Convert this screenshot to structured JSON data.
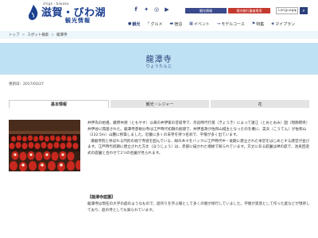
{
  "header": {
    "logo_sub": "shiga · biwako",
    "logo_main": "滋賀・びわ湖",
    "logo_tag": "観光情報",
    "social": [
      "f-icon",
      "twitter-icon",
      "instagram-icon",
      "youtube-icon"
    ],
    "top_tabs": [
      "観光情報",
      "県内旅行業者専用"
    ],
    "language_label": "Language",
    "nav": [
      {
        "icon": "map-pin-icon",
        "label": "観光"
      },
      {
        "icon": "utensils-icon",
        "label": "グルメ"
      },
      {
        "icon": "bed-icon",
        "label": "宿泊"
      },
      {
        "icon": "calendar-icon",
        "label": "イベント"
      },
      {
        "icon": "route-icon",
        "label": "モデルコース"
      },
      {
        "icon": "flag-icon",
        "label": "特集"
      },
      {
        "icon": "map-icon",
        "label": "マイプラン"
      }
    ]
  },
  "breadcrumb": [
    "トップ",
    "スポット検索",
    "龍潭寺"
  ],
  "hero": {
    "title": "龍潭寺",
    "subtitle": "りょうたんじ"
  },
  "updated": "更新日：2017/03/27",
  "tabs": [
    "基本情報",
    "観光・レジャー",
    "花"
  ],
  "body": {
    "p1": "井伊氏の始祖、藤原共保（ともやす）以来の井伊家の菩提寺で、奈良時代行基（ぎょうき）によって遠江（とおとおみ）国（現静岡県）井伊谷に開基された。龍潭寺彦根分寺は江戸時代初期の創建で、井伊直政が佐和山城主となったのを機に、昊天（こうてん）が佐和山（232.5m）山麓に移築しました。近畿に多くの末寺を持つ名刹で、学僧が多く出ています。",
    "p2": "溝脇寺院と呼ばれる円形の堀で寺道を囲んでいる、緑の木々をバックに江戸時代中・後期に建立された本堂をはじめとする諸堂が並びます。江戸時代初期に建立された方丈（ほうじょう）は、赤部に描かれた襖絵で知られています。方丈にある庭園は禅の庭で、池泉回遊式の庭園と合わせて2つの名園が見られます。",
    "section_heading": "【龍潭寺庭園】",
    "p3": "龍潭寺は現在の大学の庭のようなもので、庭作りを学ぶ場として多くの僧が修行していました。学僧が実習として作った庭などが現存しており、庭の寺としても知られています。"
  }
}
